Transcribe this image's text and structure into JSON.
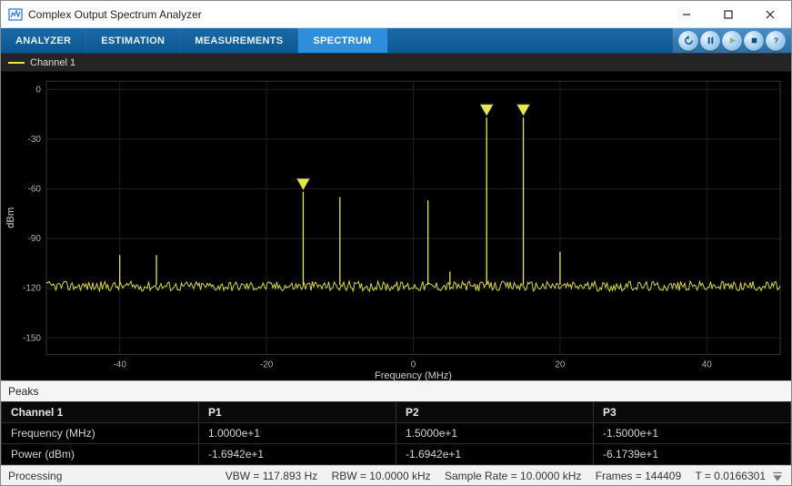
{
  "window": {
    "title": "Complex Output Spectrum Analyzer"
  },
  "tabs": {
    "analyzer": "ANALYZER",
    "estimation": "ESTIMATION",
    "measurements": "MEASUREMENTS",
    "spectrum": "SPECTRUM",
    "active": "spectrum"
  },
  "legend": {
    "channel1": "Channel 1"
  },
  "axes": {
    "ylabel": "dBm",
    "xlabel": "Frequency (MHz)",
    "yticks": [
      0,
      -30,
      -60,
      -90,
      -120,
      -150
    ],
    "xticks": [
      -40,
      -20,
      0,
      20,
      40
    ]
  },
  "peaks_panel": {
    "title": "Peaks",
    "ch_label": "Channel 1",
    "col_p1": "P1",
    "col_p2": "P2",
    "col_p3": "P3",
    "row_freq": "Frequency (MHz)",
    "row_pow": "Power (dBm)",
    "freq": {
      "p1": "1.0000e+1",
      "p2": "1.5000e+1",
      "p3": "-1.5000e+1"
    },
    "pow": {
      "p1": "-1.6942e+1",
      "p2": "-1.6942e+1",
      "p3": "-6.1739e+1"
    }
  },
  "status": {
    "left": "Processing",
    "vbw": "VBW = 117.893 Hz",
    "rbw": "RBW = 10.0000 kHz",
    "sample_rate": "Sample Rate = 10.0000 kHz",
    "frames": "Frames = 144409",
    "t": "T = 0.0166301"
  },
  "chart_data": {
    "type": "line",
    "title": "",
    "xlabel": "Frequency (MHz)",
    "ylabel": "dBm",
    "xlim": [
      -50,
      50
    ],
    "ylim": [
      -160,
      5
    ],
    "noise_floor_dbm": -120,
    "noise_jitter_dbm": 6,
    "series": [
      {
        "name": "Channel 1",
        "color": "#e8e84a",
        "peaks": [
          {
            "freq_mhz": -40,
            "power_dbm": -100
          },
          {
            "freq_mhz": -35,
            "power_dbm": -100
          },
          {
            "freq_mhz": -15,
            "power_dbm": -61.739,
            "marker": true
          },
          {
            "freq_mhz": -10,
            "power_dbm": -65
          },
          {
            "freq_mhz": 2,
            "power_dbm": -67
          },
          {
            "freq_mhz": 5,
            "power_dbm": -110
          },
          {
            "freq_mhz": 10,
            "power_dbm": -16.942,
            "marker": true
          },
          {
            "freq_mhz": 15,
            "power_dbm": -16.942,
            "marker": true
          },
          {
            "freq_mhz": 20,
            "power_dbm": -98
          }
        ]
      }
    ]
  }
}
